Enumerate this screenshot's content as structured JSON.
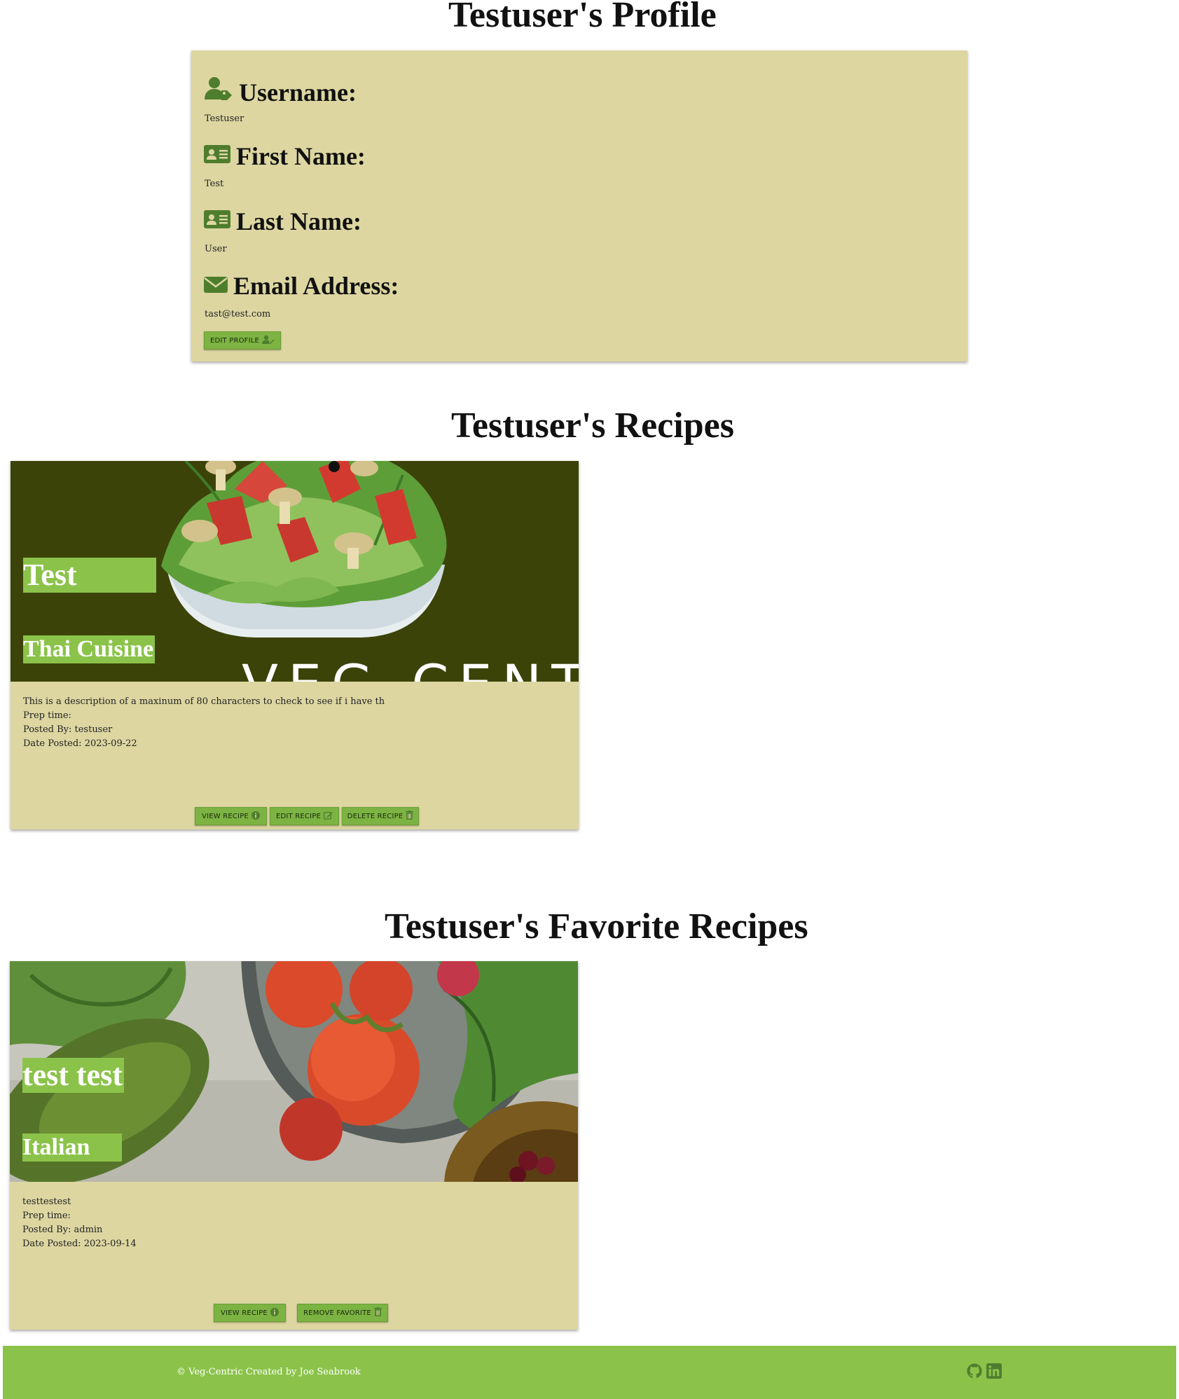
{
  "profile": {
    "title": "Testuser's Profile",
    "fields": [
      {
        "label": "Username:",
        "value": "Testuser",
        "icon": "user-tag-icon"
      },
      {
        "label": "First Name:",
        "value": "Test",
        "icon": "id-card-icon"
      },
      {
        "label": "Last Name:",
        "value": "User",
        "icon": "id-card-icon"
      },
      {
        "label": "Email Address:",
        "value": "tast@test.com",
        "icon": "envelope-icon"
      }
    ],
    "edit_button": "EDIT PROFILE"
  },
  "recipes": {
    "title": "Testuser's Recipes",
    "items": [
      {
        "name": "Test",
        "cuisine": "Thai Cuisine",
        "description": "This is a description of a maxinum of 80 characters to check to see if i have th",
        "prep_time": "Prep time:",
        "posted_by": "Posted By: testuser",
        "date_posted": "Date Posted: 2023-09-22",
        "image_watermark": "VEG-CENTRIC",
        "buttons": {
          "view": "VIEW RECIPE",
          "edit": "EDIT RECIPE",
          "delete": "DELETE RECIPE"
        }
      }
    ]
  },
  "favorites": {
    "title": "Testuser's Favorite Recipes",
    "items": [
      {
        "name": "test test",
        "cuisine": "Italian",
        "description": "testtestest",
        "prep_time": "Prep time:",
        "posted_by": "Posted By: admin",
        "date_posted": "Date Posted: 2023-09-14",
        "buttons": {
          "view": "VIEW RECIPE",
          "remove": "REMOVE FAVORITE"
        }
      }
    ]
  },
  "footer": {
    "text": "© Veg-Centric Created by Joe Seabrook",
    "icons": [
      "github-icon",
      "linkedin-icon"
    ]
  },
  "colors": {
    "card_bg": "#ddd6a1",
    "accent_green": "#8bc34a",
    "button_green": "#7cb342",
    "icon_green": "#4e7d2e",
    "dark_olive": "#3c4309"
  }
}
